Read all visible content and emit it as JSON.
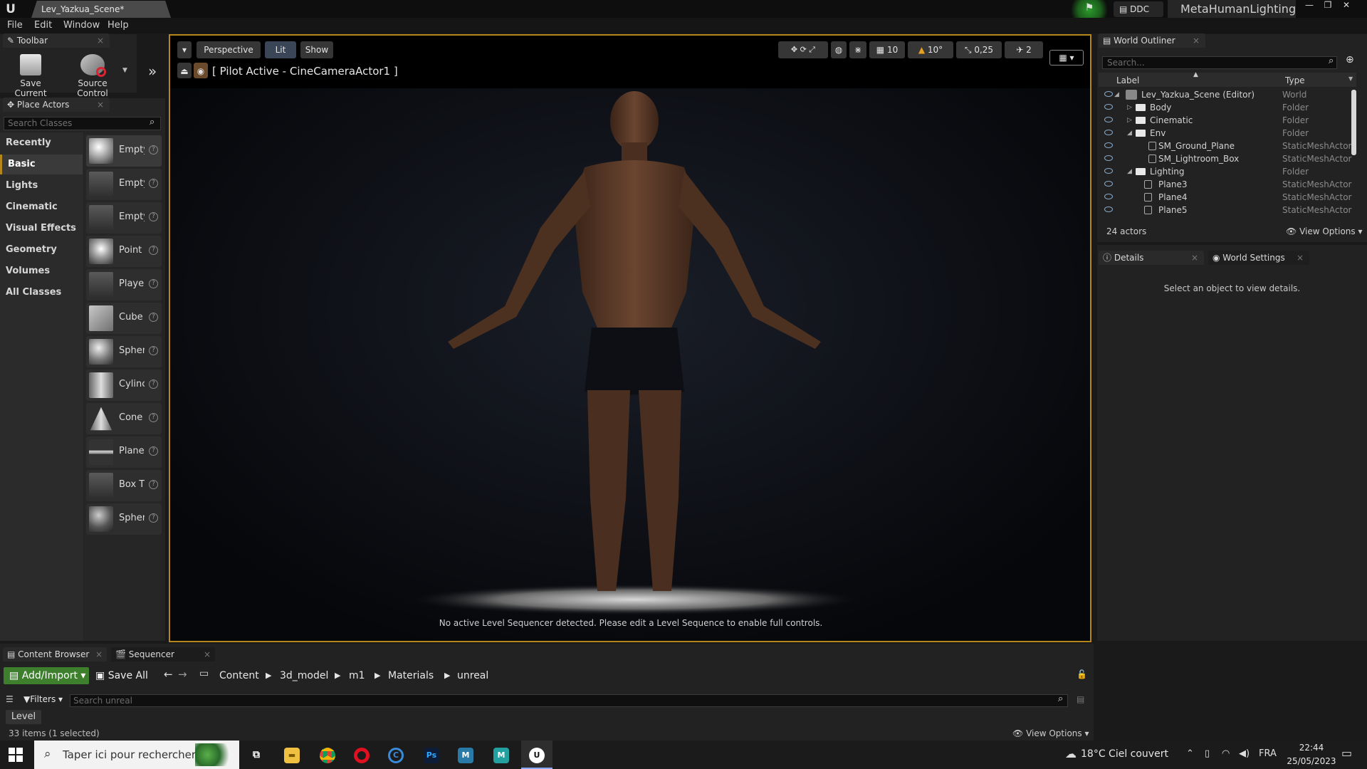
{
  "titlebar": {
    "doc_tab": "Lev_Yazkua_Scene*",
    "ddc": "DDC",
    "project": "MetaHumanLighting"
  },
  "menu": [
    "File",
    "Edit",
    "Window",
    "Help"
  ],
  "toolbar_panel": {
    "title": "Toolbar",
    "save_label": "Save Current",
    "source_label": "Source Control"
  },
  "place_actors": {
    "title": "Place Actors",
    "search_placeholder": "Search Classes",
    "categories": [
      "Recently Placed",
      "Basic",
      "Lights",
      "Cinematic",
      "Visual Effects",
      "Geometry",
      "Volumes",
      "All Classes"
    ],
    "items": [
      "Empty",
      "Empty",
      "Empty",
      "Point",
      "Playe",
      "Cube",
      "Spher",
      "Cylinc",
      "Cone",
      "Plane",
      "Box T",
      "Spher"
    ]
  },
  "viewport": {
    "perspective": "Perspective",
    "lit": "Lit",
    "show": "Show",
    "pilot": "[ Pilot Active - CineCameraActor1 ]",
    "grid_snap": "10",
    "rot_snap": "10°",
    "scale_snap": "0,25",
    "cam_speed": "2",
    "message": "No active Level Sequencer detected. Please edit a Level Sequence to enable full controls."
  },
  "outliner": {
    "title": "World Outliner",
    "search_placeholder": "Search...",
    "col_label": "Label",
    "col_type": "Type",
    "rows": [
      {
        "label": "Lev_Yazkua_Scene (Editor)",
        "type": "World"
      },
      {
        "label": "Body",
        "type": "Folder"
      },
      {
        "label": "Cinematic",
        "type": "Folder"
      },
      {
        "label": "Env",
        "type": "Folder"
      },
      {
        "label": "SM_Ground_Plane",
        "type": "StaticMeshActor"
      },
      {
        "label": "SM_Lightroom_Box",
        "type": "StaticMeshActor"
      },
      {
        "label": "Lighting",
        "type": "Folder"
      },
      {
        "label": "Plane3",
        "type": "StaticMeshActor"
      },
      {
        "label": "Plane4",
        "type": "StaticMeshActor"
      },
      {
        "label": "Plane5",
        "type": "StaticMeshActor"
      }
    ],
    "count": "24 actors",
    "view_options": "View Options"
  },
  "details": {
    "tab_details": "Details",
    "tab_world": "World Settings",
    "empty_msg": "Select an object to view details."
  },
  "content_browser": {
    "tab_cb": "Content Browser",
    "tab_seq": "Sequencer",
    "add_import": "Add/Import",
    "save_all": "Save All",
    "path": [
      "Content",
      "3d_model",
      "m1",
      "Materials",
      "unreal"
    ],
    "filters": "Filters",
    "search_placeholder": "Search unreal",
    "level_label": "Level",
    "count": "33 items (1 selected)",
    "view_options": "View Options"
  },
  "taskbar": {
    "search": "Taper ici pour rechercher",
    "weather": "18°C Ciel couvert",
    "lang": "FRA",
    "time": "22:44",
    "date": "25/05/2023"
  },
  "colors": {
    "accent": "#b5861a",
    "add_import": "#3d7f2c",
    "orb": "#2c9a2c"
  }
}
